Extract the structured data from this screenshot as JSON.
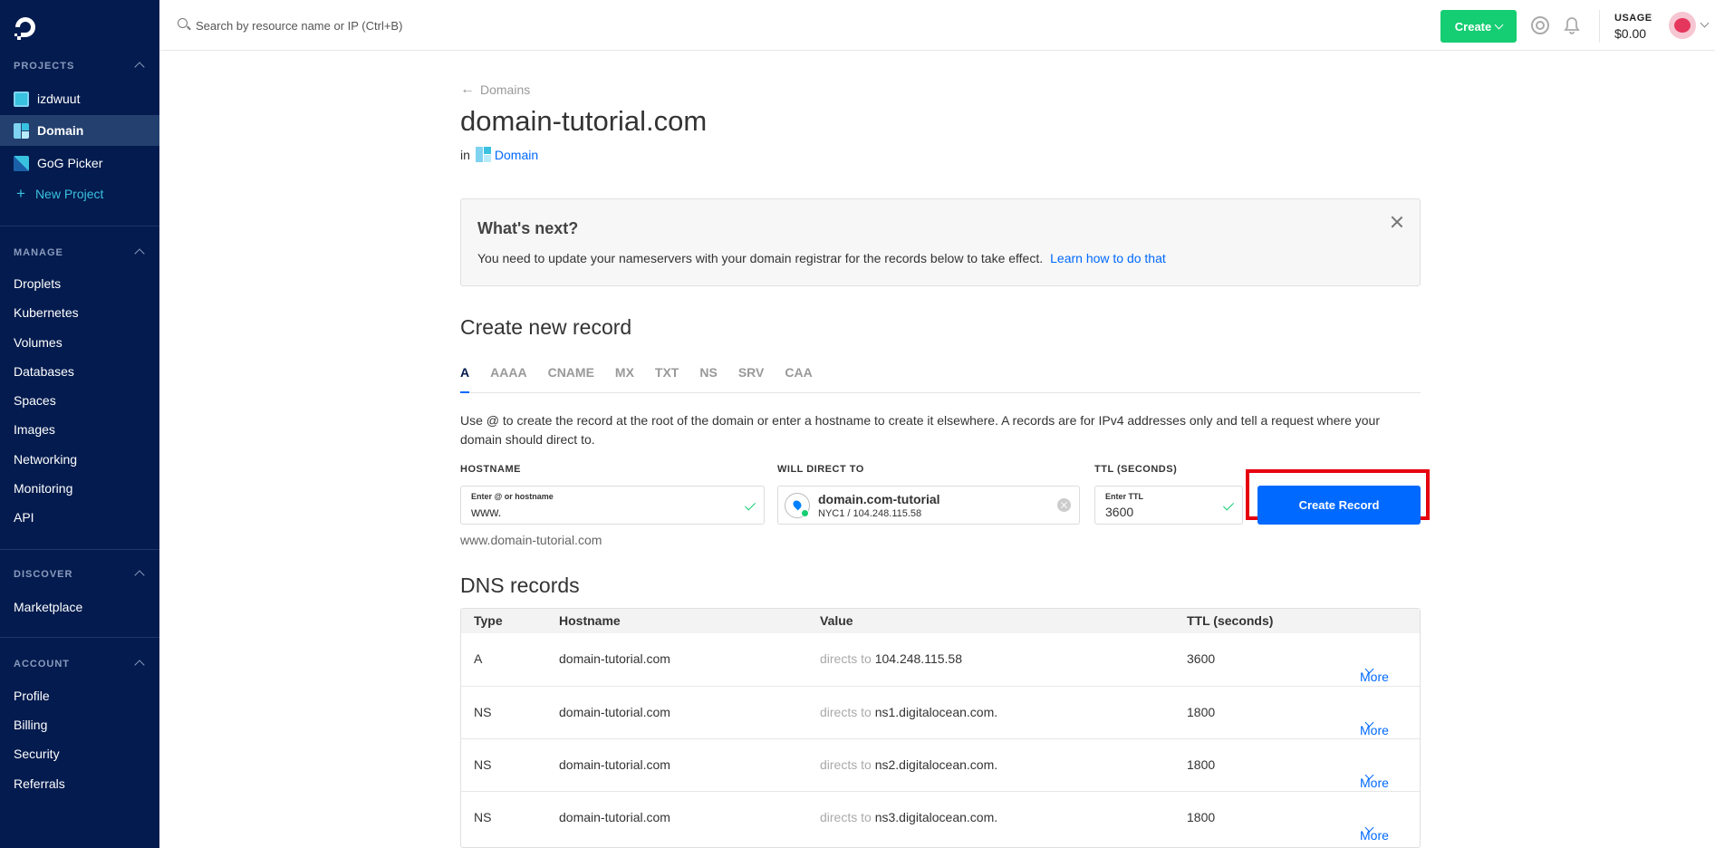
{
  "search": {
    "placeholder": "Search by resource name or IP (Ctrl+B)"
  },
  "topbar": {
    "create_label": "Create",
    "usage_label": "USAGE",
    "usage_value": "$0.00"
  },
  "sidebar": {
    "projects_header": "PROJECTS",
    "projects": [
      {
        "label": "izdwuut",
        "color": "#39c1e0"
      },
      {
        "label": "Domain",
        "color": "#7fd3f0"
      },
      {
        "label": "GoG Picker",
        "color": "#39c1e0"
      }
    ],
    "new_project": "New Project",
    "manage_header": "MANAGE",
    "manage": [
      "Droplets",
      "Kubernetes",
      "Volumes",
      "Databases",
      "Spaces",
      "Images",
      "Networking",
      "Monitoring",
      "API"
    ],
    "discover_header": "DISCOVER",
    "discover": [
      "Marketplace"
    ],
    "account_header": "ACCOUNT",
    "account": [
      "Profile",
      "Billing",
      "Security",
      "Referrals"
    ]
  },
  "main": {
    "back_link": "Domains",
    "title": "domain-tutorial.com",
    "in_label": "in",
    "project_link": "Domain",
    "banner": {
      "title": "What's next?",
      "text": "You need to update your nameservers with your domain registrar for the records below to take effect.",
      "link": "Learn how to do that"
    },
    "create_heading": "Create new record",
    "tabs": [
      "A",
      "AAAA",
      "CNAME",
      "MX",
      "TXT",
      "NS",
      "SRV",
      "CAA"
    ],
    "active_tab": "A",
    "description": "Use @ to create the record at the root of the domain or enter a hostname to create it elsewhere. A records are for IPv4 addresses only and tell a request where your domain should direct to.",
    "hostname": {
      "label": "HOSTNAME",
      "mini": "Enter @ or hostname",
      "value": "www."
    },
    "direct": {
      "label": "WILL DIRECT TO",
      "name": "domain.com-tutorial",
      "sub": "NYC1 / 104.248.115.58"
    },
    "ttl": {
      "label": "TTL (SECONDS)",
      "mini": "Enter TTL",
      "value": "3600"
    },
    "create_button": "Create Record",
    "preview": "www.domain-tutorial.com",
    "dns_heading": "DNS records",
    "table": {
      "headers": [
        "Type",
        "Hostname",
        "Value",
        "TTL (seconds)"
      ],
      "rows": [
        {
          "type": "A",
          "hostname": "domain-tutorial.com",
          "prefix": "directs to",
          "value": "104.248.115.58",
          "ttl": "3600",
          "more": "More"
        },
        {
          "type": "NS",
          "hostname": "domain-tutorial.com",
          "prefix": "directs to",
          "value": "ns1.digitalocean.com.",
          "ttl": "1800",
          "more": "More"
        },
        {
          "type": "NS",
          "hostname": "domain-tutorial.com",
          "prefix": "directs to",
          "value": "ns2.digitalocean.com.",
          "ttl": "1800",
          "more": "More"
        },
        {
          "type": "NS",
          "hostname": "domain-tutorial.com",
          "prefix": "directs to",
          "value": "ns3.digitalocean.com.",
          "ttl": "1800",
          "more": "More"
        }
      ]
    }
  }
}
